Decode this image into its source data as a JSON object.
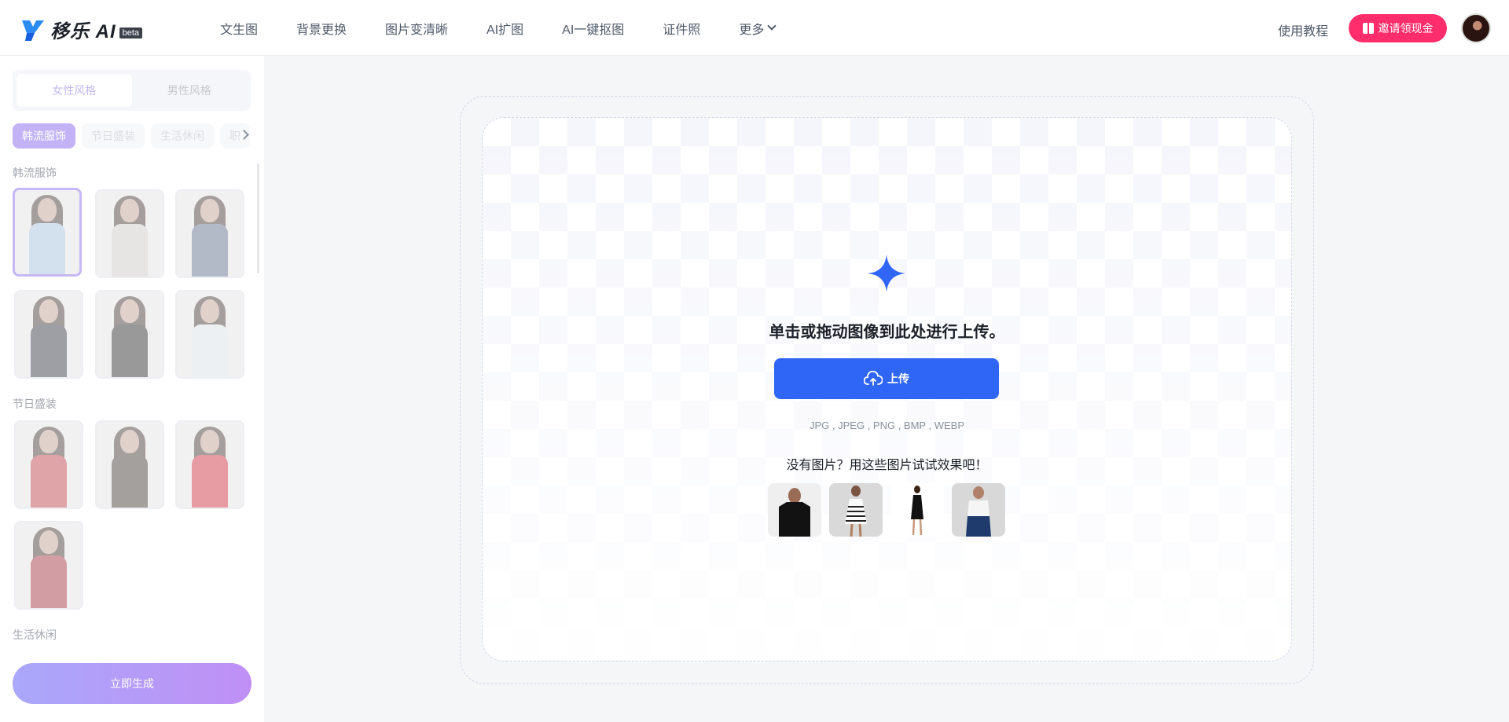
{
  "header": {
    "logo_text": "移乐 AI",
    "beta": "beta",
    "nav": [
      "文生图",
      "背景更换",
      "图片变清晰",
      "AI扩图",
      "AI一键抠图",
      "证件照",
      "更多"
    ],
    "tutorial": "使用教程",
    "invite": "邀请领现金"
  },
  "sidebar": {
    "tabs": [
      "女性风格",
      "男性风格"
    ],
    "chips": [
      "韩流服饰",
      "节日盛装",
      "生活休闲",
      "职"
    ],
    "sections": [
      "韩流服饰",
      "节日盛装",
      "生活休闲"
    ],
    "generate": "立即生成"
  },
  "main": {
    "drop_title": "单击或拖动图像到此处进行上传。",
    "upload_label": "上传",
    "formats": "JPG , JPEG , PNG , BMP , WEBP",
    "try_text": "没有图片？用这些图片试试效果吧！"
  },
  "colors": {
    "primary": "#2f66f5",
    "invite": "#ff2d6b",
    "accent_purple": "#c3b3f6"
  }
}
